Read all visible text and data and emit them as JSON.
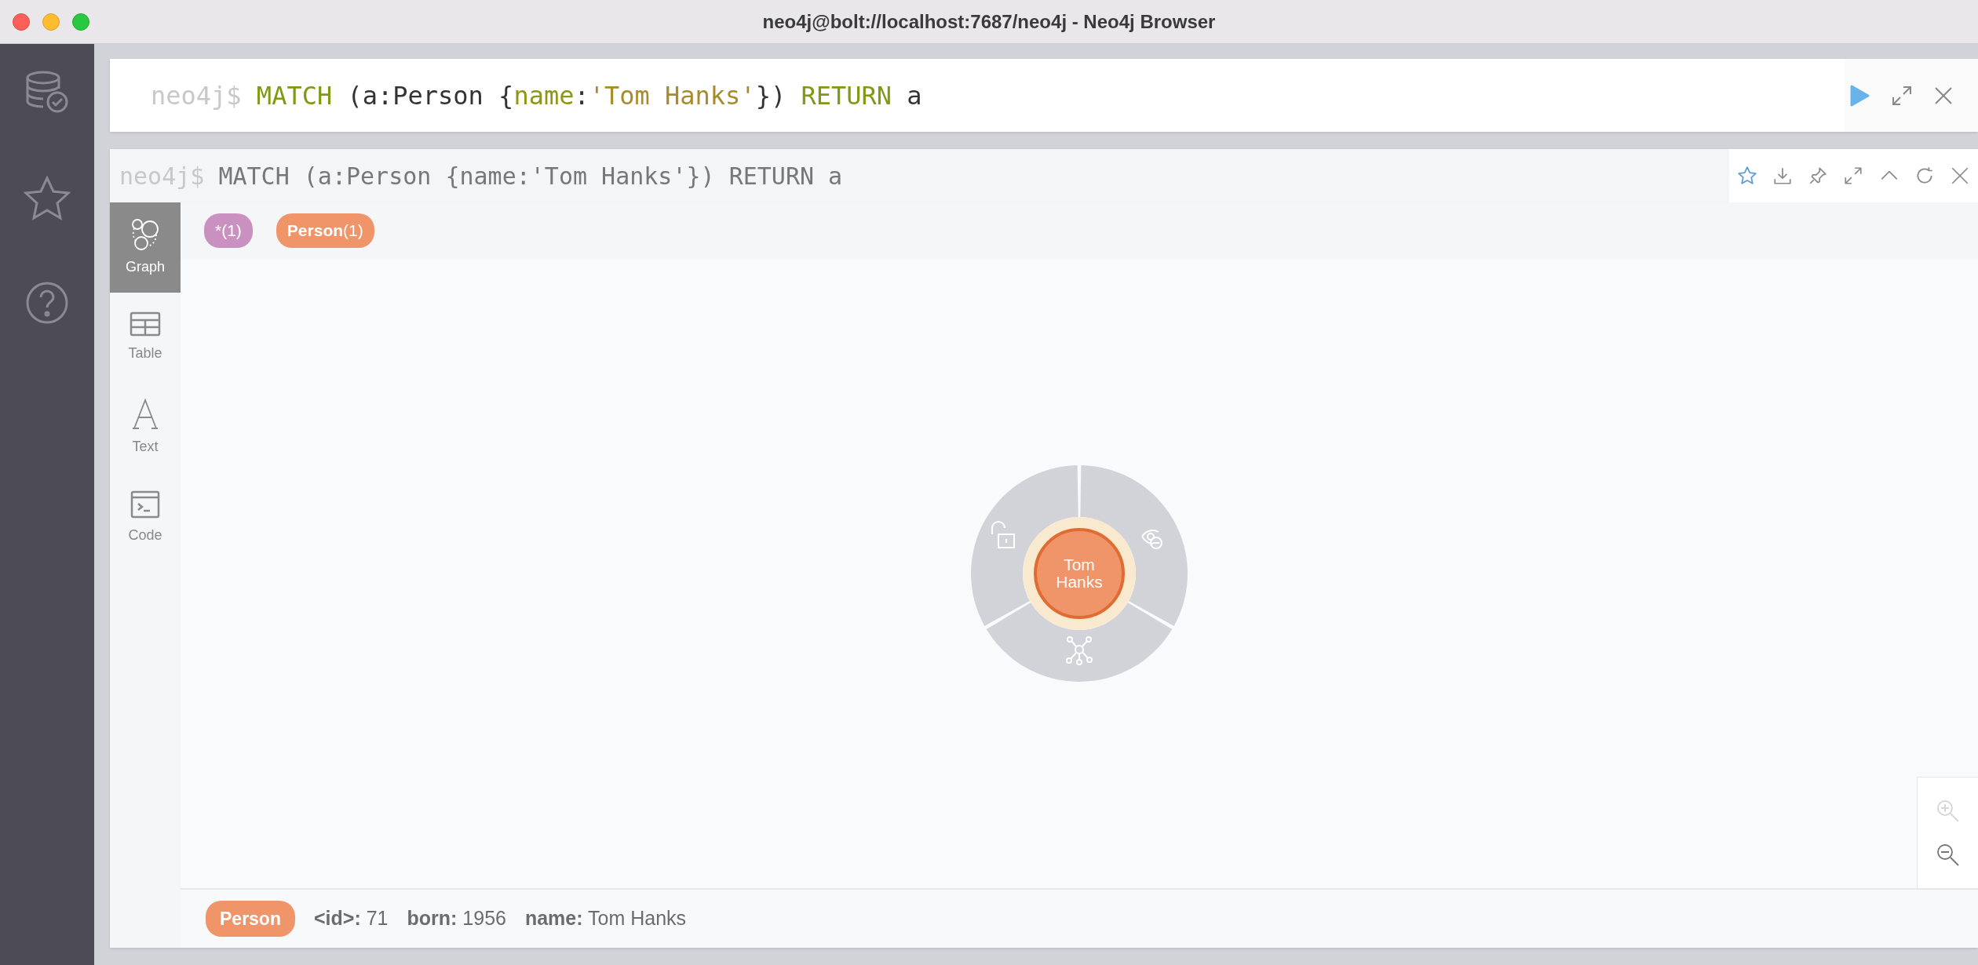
{
  "window": {
    "title": "neo4j@bolt://localhost:7687/neo4j - Neo4j Browser"
  },
  "editor": {
    "prompt": "neo4j$",
    "tokens": [
      {
        "kind": "keyword",
        "text": "MATCH"
      },
      {
        "kind": "plain",
        "text": " (a:Person {"
      },
      {
        "kind": "property",
        "text": "name"
      },
      {
        "kind": "plain",
        "text": ":"
      },
      {
        "kind": "string",
        "text": "'Tom Hanks'"
      },
      {
        "kind": "plain",
        "text": "}) "
      },
      {
        "kind": "keyword",
        "text": "RETURN"
      },
      {
        "kind": "plain",
        "text": " a"
      }
    ]
  },
  "result": {
    "prompt": "neo4j$",
    "query": "MATCH (a:Person {name:'Tom Hanks'}) RETURN a",
    "tabs": [
      {
        "label": "Graph",
        "selected": true
      },
      {
        "label": "Table",
        "selected": false
      },
      {
        "label": "Text",
        "selected": false
      },
      {
        "label": "Code",
        "selected": false
      }
    ],
    "labels": [
      {
        "text": "*(1)",
        "color": "#c990c0"
      },
      {
        "text": "**Person**(1)",
        "color": "#f0956a"
      }
    ],
    "graph": {
      "nodes": [
        {
          "caption": "Tom Hanks",
          "color": "#f0956a",
          "selected": true
        }
      ]
    },
    "zoom": [
      {
        "disabled": true
      },
      {
        "disabled": false
      }
    ],
    "details": {
      "label": {
        "text": "Person",
        "color": "#f0956a"
      },
      "properties": [
        "**<id>:** 71",
        "**born:** 1956",
        "**name:** Tom Hanks"
      ]
    }
  }
}
